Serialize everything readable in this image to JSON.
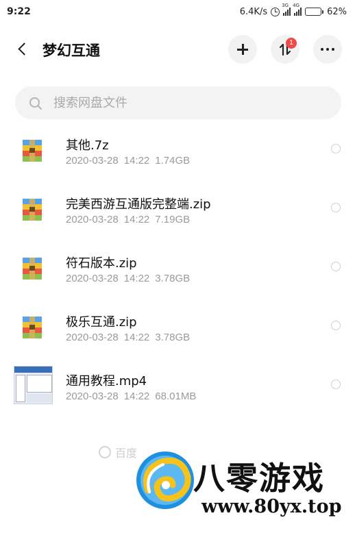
{
  "status_bar": {
    "time": "9:22",
    "network_speed": "6.4K/s",
    "signal_1_label": "3G",
    "signal_2_label": "4G",
    "battery": "62%",
    "battery_level": 0.62,
    "icons": [
      "alarm-icon",
      "signal-icon",
      "battery-icon"
    ]
  },
  "header": {
    "title": "梦幻互通",
    "back_icon": "chevron-left-icon",
    "add_icon": "plus-icon",
    "sort_icon": "transfer-icon",
    "sort_badge": "1",
    "more_icon": "more-dots-icon"
  },
  "search": {
    "placeholder": "搜索网盘文件",
    "value": ""
  },
  "files": [
    {
      "name": "其他.7z",
      "date": "2020-03-28",
      "time": "14:22",
      "size": "1.74GB",
      "type": "archive"
    },
    {
      "name": "完美西游互通版完整端.zip",
      "date": "2020-03-28",
      "time": "14:22",
      "size": "7.19GB",
      "type": "archive"
    },
    {
      "name": "符石版本.zip",
      "date": "2020-03-28",
      "time": "14:22",
      "size": "3.78GB",
      "type": "archive"
    },
    {
      "name": "极乐互通.zip",
      "date": "2020-03-28",
      "time": "14:22",
      "size": "3.78GB",
      "type": "archive"
    },
    {
      "name": "通用教程.mp4",
      "date": "2020-03-28",
      "time": "14:22",
      "size": "68.01MB",
      "type": "video"
    }
  ],
  "watermark": {
    "faint_text": "百度",
    "brand_name": "八零游戏",
    "brand_url": "www.80yx.top"
  },
  "colors": {
    "badge": "#ef4a4a",
    "search_bg": "#f3f3f3",
    "meta_text": "#9a9a9a",
    "button_bg": "#f2f2f2"
  }
}
